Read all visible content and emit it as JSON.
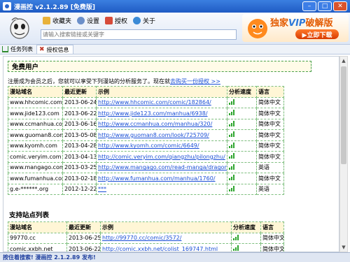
{
  "window": {
    "title": "漫画控 v2.1.2.89 [免费版]"
  },
  "toolbar": {
    "favorites": "收藏夹",
    "settings": "设置",
    "authorize": "授权",
    "about": "关于"
  },
  "search": {
    "placeholder": "请输入搜索链接或关键字"
  },
  "vip": {
    "text_prefix": "独家",
    "text_vip": "VIP",
    "text_suffix": "破解版",
    "button": "▶立即下载"
  },
  "tabs": [
    {
      "label": "任务列表"
    },
    {
      "label": "授权信息"
    }
  ],
  "free_user": {
    "title": "免费用户",
    "notice": "注册成为会员之后，您就可以享受下列漫站的分析服务了。现在就",
    "notice_link": "去购买一份授权 >>"
  },
  "vip_sites": {
    "headers": [
      "漫站域名",
      "最近更新",
      "示例",
      "分析速度",
      "语言"
    ],
    "rows": [
      {
        "domain": "www.hhcomic.com",
        "date": "2013-06-24",
        "url": "http://www.hhcomic.com/comic/182864/",
        "lang": "简体中文"
      },
      {
        "domain": "www.jide123.com",
        "date": "2013-06-22",
        "url": "http://www.jide123.com/manhua/6938/",
        "lang": "简体中文"
      },
      {
        "domain": "www.ccmanhua.com",
        "date": "2013-06-16",
        "url": "http://www.ccmanhua.com/manhua/320/",
        "lang": "简体中文"
      },
      {
        "domain": "www.guoman8.com",
        "date": "2013-05-08",
        "url": "http://www.guoman8.com/look/725709/",
        "lang": "简体中文"
      },
      {
        "domain": "www.kyomh.com",
        "date": "2013-04-28",
        "url": "http://www.kyomh.com/comic/6649/",
        "lang": "简体中文"
      },
      {
        "domain": "comic.veryim.com",
        "date": "2013-04-13",
        "url": "http://comic.veryim.com/qiangzhu/pilongzhu/",
        "lang": "简体中文"
      },
      {
        "domain": "www.mangago.com",
        "date": "2013-03-25",
        "url": "http://www.mangago.com/read-manga/dragon_ball/",
        "lang": "英语"
      },
      {
        "domain": "www.fumanhua.com",
        "date": "2013-02-18",
        "url": "http://www.fumanhua.com/manhua/1760/",
        "lang": "简体中文"
      },
      {
        "domain": "g.e-******.org",
        "date": "2012-12-22",
        "url": "***",
        "lang": "英语"
      }
    ]
  },
  "supported": {
    "title": "支持站点列表",
    "headers": [
      "漫站域名",
      "最近更新",
      "示例",
      "分析速度",
      "语言"
    ],
    "rows": [
      {
        "domain": "99770.cc",
        "date": "2013-06-25",
        "url": "http://99770.cc/comic/3572/",
        "lang": "简体中文"
      },
      {
        "domain": "comic.xxbh.net",
        "date": "2013-06-22",
        "url": "http://comic.xxbh.net/colist_169747.html",
        "lang": "简体中文"
      }
    ]
  },
  "status": {
    "text": "按住着搜索! 漫画控 2.1.2.89 发布!"
  },
  "colors": {
    "titlebar": "#2b65c8",
    "link": "#1a4fd6",
    "border": "#7fbf7f",
    "signal": "#2ea52e"
  }
}
